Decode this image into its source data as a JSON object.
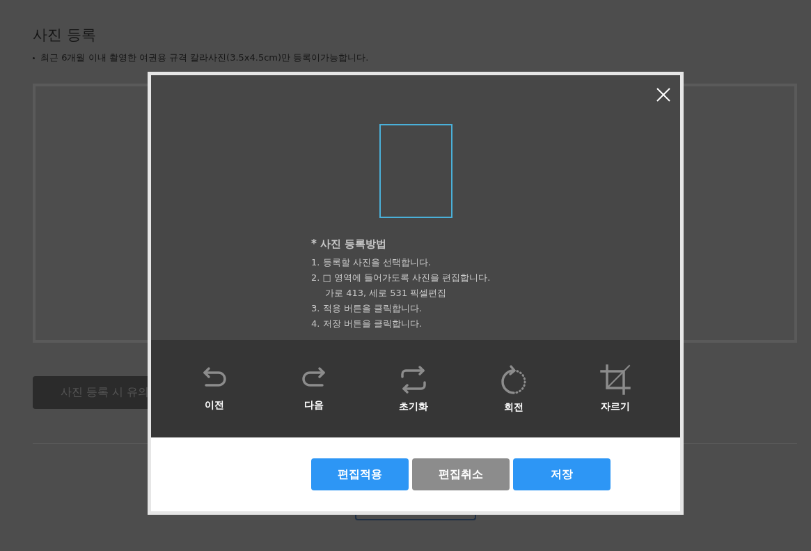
{
  "page": {
    "title": "사진 등록",
    "notice": "최근 6개월 이내 촬영한 여권용 규격 칼라사진(3.5x4.5cm)만 등록이가능합니다.",
    "guide_button": "사진 등록 시 유의"
  },
  "modal": {
    "instructions": {
      "heading": "* 사진 등록방법",
      "lines": [
        {
          "kind": "step",
          "text": "1. 등록할 사진을 선택합니다."
        },
        {
          "kind": "step",
          "text": "2. □ 영역에 들어가도록 사진을 편집합니다."
        },
        {
          "kind": "sub",
          "text": "가로 413, 세로 531 픽셀편집"
        },
        {
          "kind": "step",
          "text": "3. 적용 버튼을 클릭합니다."
        },
        {
          "kind": "step",
          "text": "4. 저장 버튼을 클릭합니다."
        }
      ]
    },
    "tools": [
      {
        "kind": "undo",
        "label": "이전"
      },
      {
        "kind": "redo",
        "label": "다음"
      },
      {
        "kind": "reset",
        "label": "초기화"
      },
      {
        "kind": "rotate",
        "label": "회전"
      },
      {
        "kind": "crop",
        "label": "자르기"
      }
    ],
    "buttons": [
      {
        "kind": "primary",
        "label": "편집적용"
      },
      {
        "kind": "secondary",
        "label": "편집취소"
      },
      {
        "kind": "primary",
        "label": "저장"
      }
    ]
  }
}
